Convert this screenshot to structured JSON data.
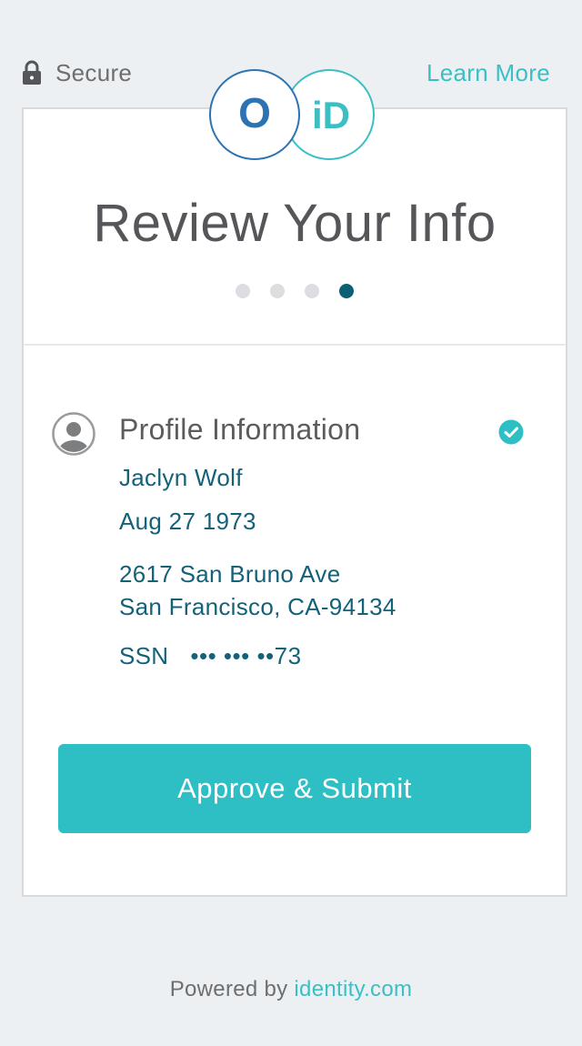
{
  "top_bar": {
    "secure_icon": "lock-icon",
    "secure_label": "Secure",
    "learn_more_label": "Learn More"
  },
  "logos": {
    "left_logo_text": "O",
    "right_logo_text": "iD",
    "left_logo_color": "#2d73b3",
    "right_logo_color": "#3bbfc5"
  },
  "header": {
    "title": "Review Your Info",
    "steps_total": 4,
    "current_step": 4
  },
  "profile": {
    "icon": "user-avatar-icon",
    "title": "Profile Information",
    "verified_icon": "check-circle-icon",
    "name": "Jaclyn Wolf",
    "dob": "Aug 27 1973",
    "address_line1": "2617 San Bruno Ave",
    "address_line2": "San Francisco, CA-94134",
    "ssn_label": "SSN",
    "ssn_value": "••• ••• ••73"
  },
  "actions": {
    "submit_label": "Approve & Submit"
  },
  "footer": {
    "powered_by": "Powered by",
    "link_text": "identity.com"
  },
  "colors": {
    "accent": "#2ebfc4",
    "text_dark_teal": "#13627a",
    "active_step": "#0d5f74",
    "background": "#edf0f3"
  }
}
